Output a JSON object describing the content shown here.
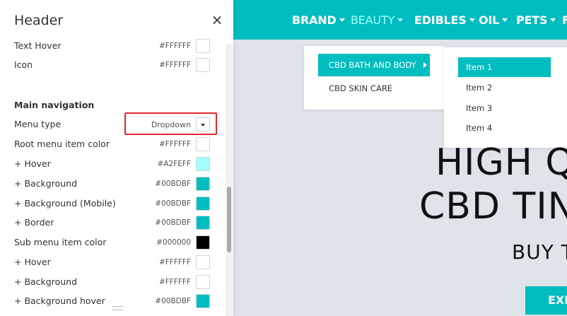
{
  "panel": {
    "title": "Header",
    "close_icon": "×",
    "rows_top": [
      {
        "label": "Text Hover",
        "hex": "#FFFFFF",
        "color": "#FFFFFF"
      },
      {
        "label": "Icon",
        "hex": "#FFFFFF",
        "color": "#FFFFFF"
      }
    ],
    "section_title": "Main navigation",
    "menu_type": {
      "label": "Menu type",
      "value": "Dropdown"
    },
    "rows_main": [
      {
        "label": "Root menu item color",
        "hex": "#FFFFFF",
        "color": "#FFFFFF"
      },
      {
        "label": "+ Hover",
        "hex": "#A2FEFF",
        "color": "#A2FEFF"
      },
      {
        "label": "+ Background",
        "hex": "#00BDBF",
        "color": "#00BDBF"
      },
      {
        "label": "+ Background (Mobile)",
        "hex": "#00BDBF",
        "color": "#00BDBF"
      },
      {
        "label": "+ Border",
        "hex": "#00BDBF",
        "color": "#00BDBF"
      },
      {
        "label": "Sub menu item color",
        "hex": "#000000",
        "color": "#000000"
      },
      {
        "label": "+ Hover",
        "hex": "#FFFFFF",
        "color": "#FFFFFF"
      },
      {
        "label": "+ Background",
        "hex": "#FFFFFF",
        "color": "#FFFFFF"
      },
      {
        "label": "+ Background hover",
        "hex": "#00BDBF",
        "color": "#00BDBF"
      }
    ]
  },
  "site": {
    "accent": "#00BDBF",
    "nav": [
      {
        "label": "BRAND",
        "hover": false
      },
      {
        "label": "BEAUTY",
        "hover": true
      },
      {
        "label": "EDIBLES",
        "hover": false
      },
      {
        "label": "OIL",
        "hover": false
      },
      {
        "label": "PETS",
        "hover": false
      },
      {
        "label": "F",
        "hover": false
      }
    ],
    "dropdown1": [
      "CBD BATH AND BODY",
      "CBD SKIN CARE"
    ],
    "dropdown2": [
      "Item 1",
      "Item 2",
      "Item 3",
      "Item 4"
    ],
    "hero": {
      "line1": "HIGH Q",
      "line2": "CBD TIN",
      "line3": "BUY T",
      "button": "EXP"
    }
  }
}
